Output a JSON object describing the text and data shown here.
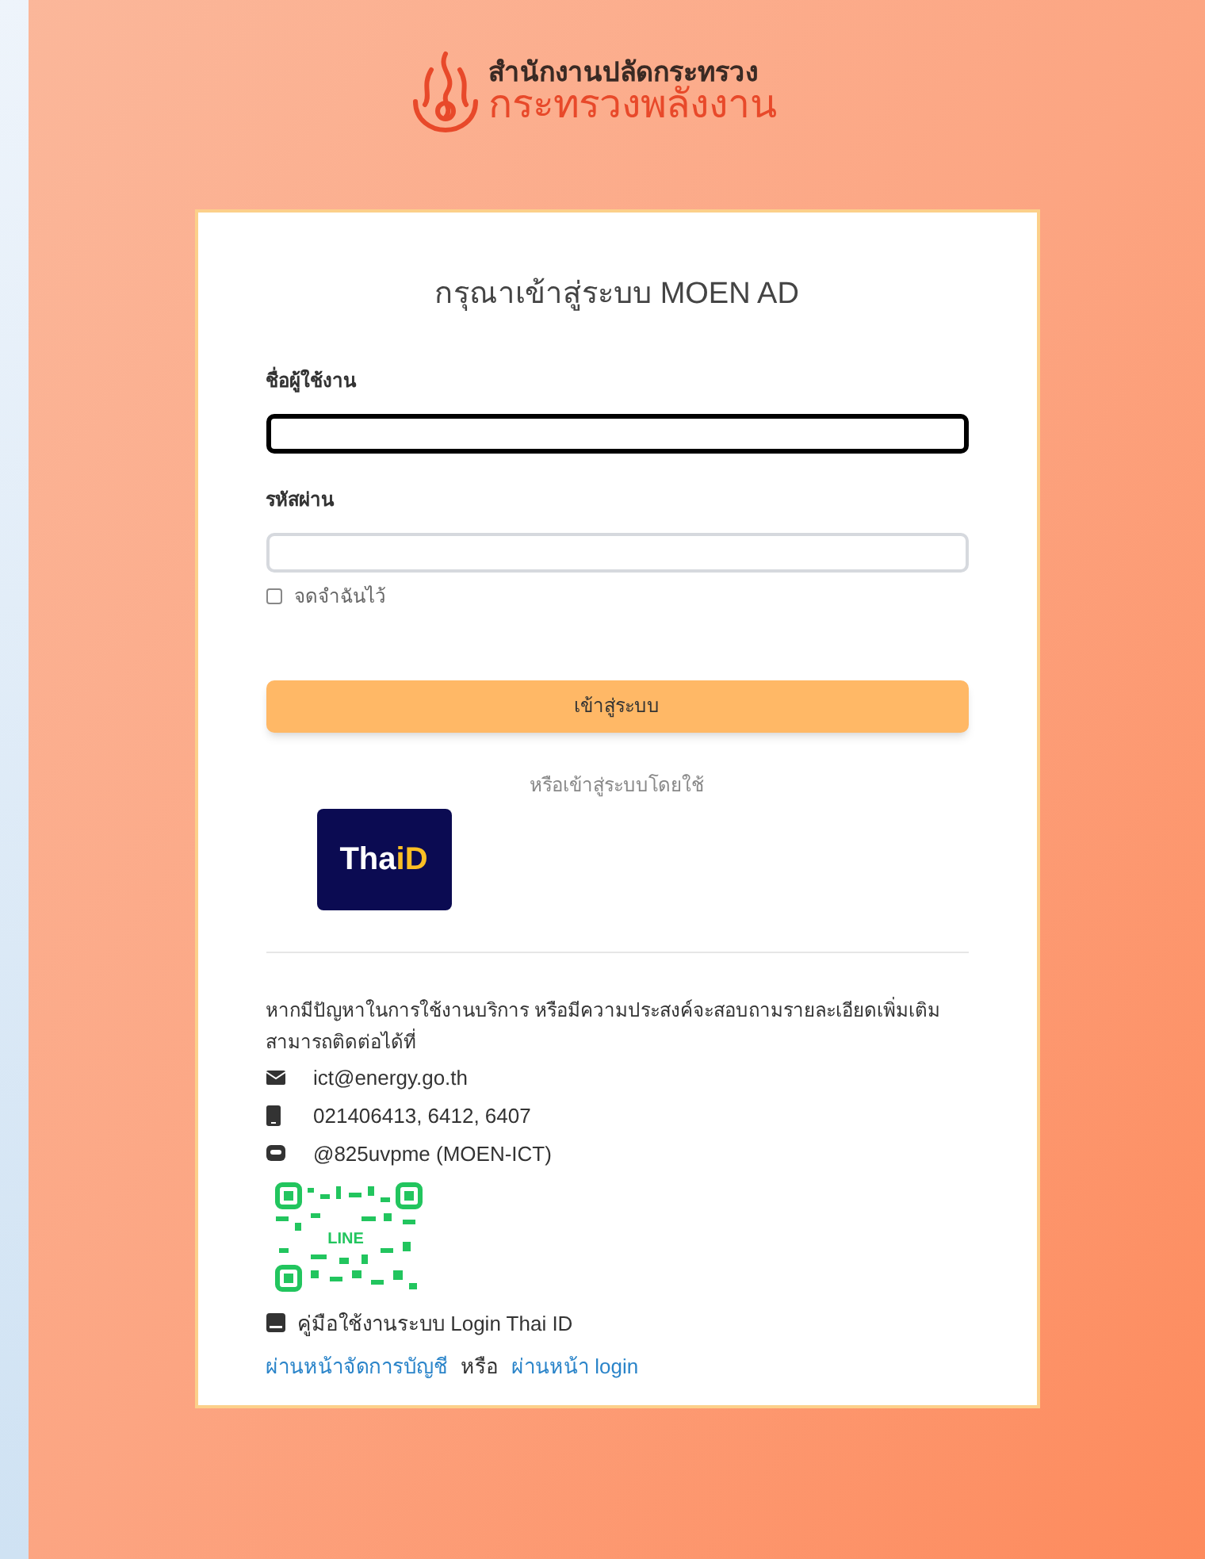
{
  "header": {
    "line_1": "สำนักงานปลัดกระทรวง",
    "line_2": "กระทรวงพลังงาน"
  },
  "login": {
    "title": "กรุณาเข้าสู่ระบบ MOEN AD",
    "fields": [
      {
        "label": "ชื่อผู้ใช้งาน",
        "focused": true
      },
      {
        "label": "รหัสผ่าน",
        "focused": false
      }
    ],
    "remember": {
      "label": "จดจำฉันไว้",
      "checked": false
    },
    "submit": "เข้าสู่ระบบ",
    "alt_login": "หรือเข้าสู่ระบบโดยใช้",
    "thaid": {
      "part_1": "Tha",
      "part_2": "iD"
    }
  },
  "help": {
    "text": "หากมีปัญหาในการใช้งานบริการ หรือมีความประสงค์จะสอบถามรายละเอียดเพิ่มเติม สามารถติดต่อได้ที่",
    "contacts": [
      {
        "kind": "email",
        "text": "ict@energy.go.th"
      },
      {
        "kind": "phone",
        "text": "021406413, 6412, 6407"
      },
      {
        "kind": "line",
        "text": "@825uvpme (MOEN-ICT)"
      }
    ],
    "qr_label": "LINE",
    "manual": "คู่มือใช้งานระบบ Login Thai ID",
    "links": [
      {
        "kind": "link",
        "text": "ผ่านหน้าจัดการบัญชี"
      },
      {
        "kind": "plain",
        "text": "หรือ"
      },
      {
        "kind": "link",
        "text": "ผ่านหน้า login"
      }
    ]
  }
}
